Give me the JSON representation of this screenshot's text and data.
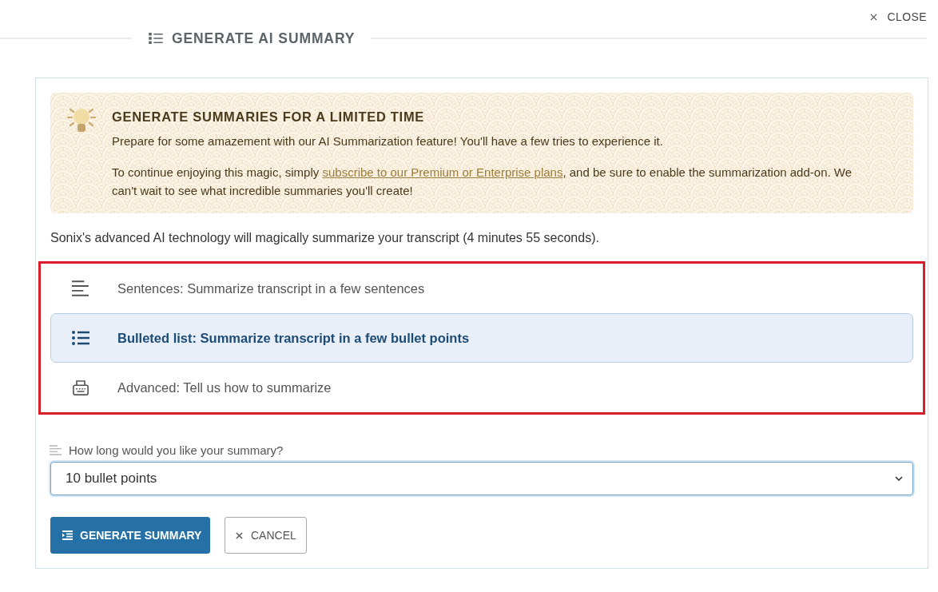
{
  "header": {
    "close": "CLOSE",
    "title": "GENERATE AI SUMMARY"
  },
  "banner": {
    "title": "GENERATE SUMMARIES FOR A LIMITED TIME",
    "intro": "Prepare for some amazement with our AI Summarization feature! You'll have a few tries to experience it.",
    "note": {
      "before": "To continue enjoying this magic, simply ",
      "link": "subscribe to our Premium or Enterprise plans",
      "after": ", and be sure to enable the summarization add-on. We can't wait to see what incredible summaries you'll create!"
    }
  },
  "description": "Sonix's advanced AI technology will magically summarize your transcript (4 minutes 55 seconds).",
  "options": [
    {
      "kind": "sentences",
      "label": "Sentences: Summarize transcript in a few sentences",
      "selected": false
    },
    {
      "kind": "bulleted",
      "label": "Bulleted list: Summarize transcript in a few bullet points",
      "selected": true
    },
    {
      "kind": "advanced",
      "label": "Advanced: Tell us how to summarize",
      "selected": false
    }
  ],
  "length": {
    "label": "How long would you like your summary?",
    "value": "10 bullet points",
    "focused": true
  },
  "buttons": [
    {
      "kind": "primary",
      "label": "GENERATE SUMMARY"
    },
    {
      "kind": "secondary",
      "label": "CANCEL"
    }
  ]
}
